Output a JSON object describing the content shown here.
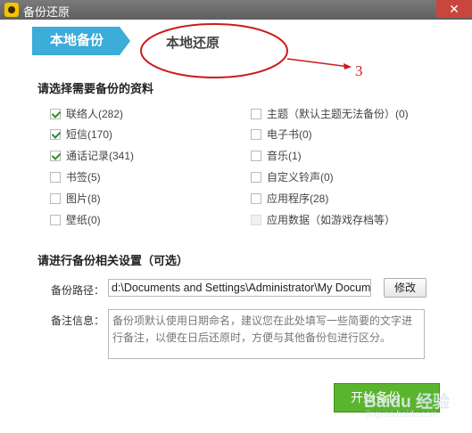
{
  "window": {
    "title": "备份还原",
    "close_glyph": "✕",
    "app_icon": "app-icon"
  },
  "tabs": {
    "backup": "本地备份",
    "restore": "本地还原"
  },
  "annotation": {
    "number": "3",
    "color": "#cc1a1a"
  },
  "section1": {
    "title": "请选择需要备份的资料",
    "left_options": [
      {
        "label": "联络人(282)",
        "checked": true
      },
      {
        "label": "短信(170)",
        "checked": true
      },
      {
        "label": "通话记录(341)",
        "checked": true
      },
      {
        "label": "书签(5)",
        "checked": false
      },
      {
        "label": "图片(8)",
        "checked": false
      },
      {
        "label": "壁纸(0)",
        "checked": false
      }
    ],
    "right_options": [
      {
        "label": "主题（默认主题无法备份）(0)",
        "checked": false
      },
      {
        "label": "电子书(0)",
        "checked": false
      },
      {
        "label": "音乐(1)",
        "checked": false
      },
      {
        "label": "自定义铃声(0)",
        "checked": false
      },
      {
        "label": "应用程序(28)",
        "checked": false
      },
      {
        "label": "应用数据（如游戏存档等）",
        "checked": false,
        "disabled": true
      }
    ]
  },
  "section2": {
    "title": "请进行备份相关设置（可选）",
    "path_label": "备份路径：",
    "path_value": "d:\\Documents and Settings\\Administrator\\My Documents",
    "modify_label": "修改",
    "note_label": "备注信息：",
    "note_placeholder": "备份项默认使用日期命名，建议您在此处填写一些简要的文字进行备注，以便在日后还原时，方便与其他备份包进行区分。"
  },
  "start_button": {
    "label": "开始备份"
  },
  "watermark": {
    "brand": "Baidu 经验",
    "sub": "jingyan.baidu.com"
  },
  "colors": {
    "tab_blue": "#3cacd9",
    "start_green": "#5ab52e",
    "titlebar": "#6b6b6b",
    "close_red": "#c9463d"
  }
}
